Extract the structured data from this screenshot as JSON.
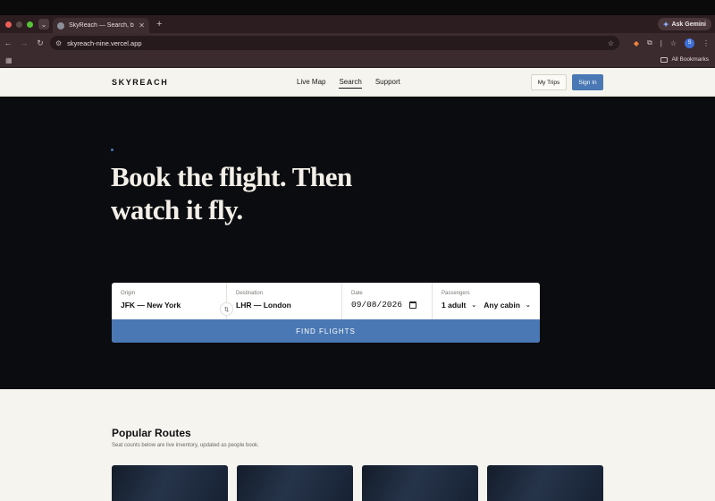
{
  "browser": {
    "tab_title": "SkyReach — Search, book and",
    "url": "skyreach-nine.vercel.app",
    "ask_label": "Ask Gemini",
    "profile_initial": "S",
    "bookmarks_label": "All Bookmarks"
  },
  "header": {
    "logo": "SKYREACH",
    "nav": [
      {
        "label": "Live Map"
      },
      {
        "label": "Search"
      },
      {
        "label": "Support"
      }
    ],
    "my_trips": "My Trips",
    "sign_in": "Sign In"
  },
  "hero": {
    "title": "Book the flight. Then watch it fly."
  },
  "search": {
    "origin_label": "Origin",
    "origin_value": "JFK — New York",
    "swap_icon": "⇅",
    "destination_label": "Destination",
    "destination_value": "LHR — London",
    "date_label": "Date",
    "date_value": "09/08/2026",
    "passengers_label": "Passengers",
    "passengers_value": "1 adult",
    "cabin_value": "Any cabin",
    "submit": "FIND FLIGHTS"
  },
  "routes": {
    "title": "Popular Routes",
    "subtitle": "Seat counts below are live inventory, updated as people book."
  },
  "colors": {
    "accent": "#4a78b4",
    "hero_bg": "#0b0c10",
    "page_bg": "#f6f4ef"
  }
}
